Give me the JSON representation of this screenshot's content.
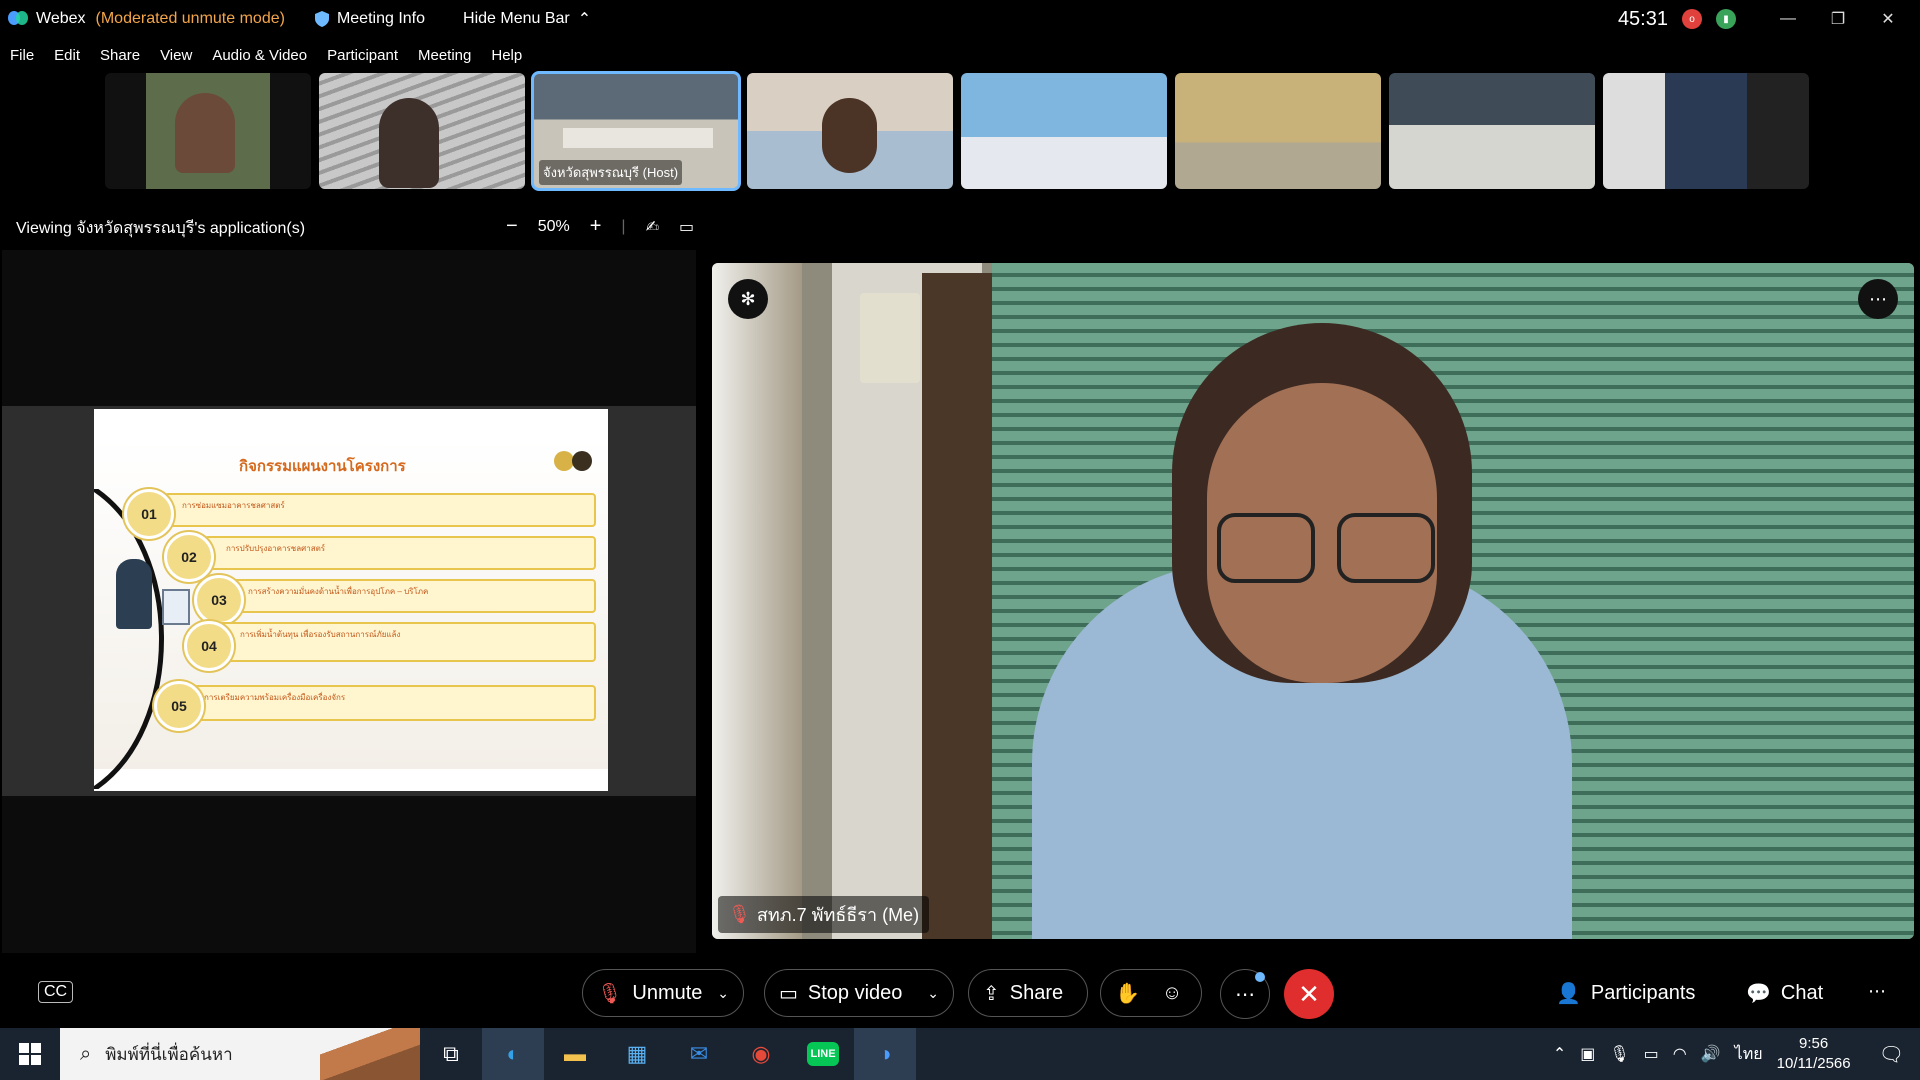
{
  "titlebar": {
    "app_name": "Webex",
    "mode": "(Moderated unmute mode)",
    "meeting_info": "Meeting Info",
    "hide_menu_bar": "Hide Menu Bar",
    "timer": "45:31",
    "record_badge": "o"
  },
  "menu": [
    "File",
    "Edit",
    "Share",
    "View",
    "Audio & Video",
    "Participant",
    "Meeting",
    "Help"
  ],
  "thumbnails": [
    {
      "label": ""
    },
    {
      "label": ""
    },
    {
      "label": "จังหวัดสุพรรณบุรี (Host)"
    },
    {
      "label": ""
    },
    {
      "label": ""
    },
    {
      "label": ""
    },
    {
      "label": ""
    },
    {
      "label": ""
    }
  ],
  "viewing": {
    "text": "Viewing จังหวัดสุพรรณบุรี's application(s)",
    "zoom": "50%"
  },
  "slide": {
    "title": "กิจกรรมแผนงานโครงการ",
    "items": [
      {
        "num": "01",
        "text": "การซ่อมแซมอาคารชลศาสตร์"
      },
      {
        "num": "02",
        "text": "การปรับปรุงอาคารชลศาสตร์"
      },
      {
        "num": "03",
        "text": "การสร้างความมั่นคงด้านน้ำเพื่อการอุปโภค – บริโภค"
      },
      {
        "num": "04",
        "text": "การเพิ่มน้ำต้นทุน เพื่อรองรับสถานการณ์ภัยแล้ง"
      },
      {
        "num": "05",
        "text": "การเตรียมความพร้อมเครื่องมือเครื่องจักร"
      }
    ]
  },
  "self_view": {
    "label": "สทภ.7 พัทธ์ธีรา (Me)"
  },
  "controls": {
    "unmute": "Unmute",
    "stop_video": "Stop video",
    "share": "Share",
    "participants": "Participants",
    "chat": "Chat"
  },
  "taskbar": {
    "search_placeholder": "พิมพ์ที่นี่เพื่อค้นหา",
    "language": "ไทย",
    "time": "9:56",
    "date": "10/11/2566"
  },
  "colors": {
    "accent": "#6eb9ff",
    "moderated": "#f3a54a",
    "end_call": "#e02d2d",
    "line_green": "#06c755"
  }
}
